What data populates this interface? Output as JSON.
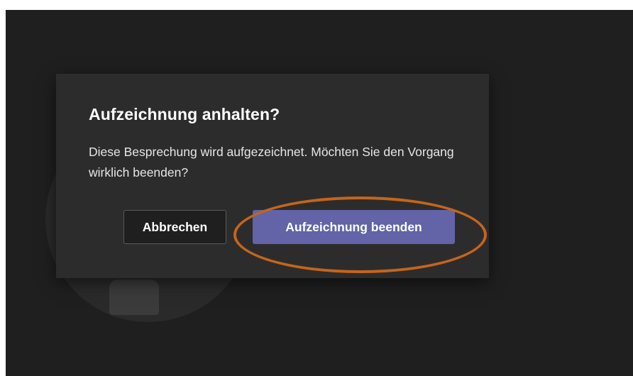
{
  "dialog": {
    "title": "Aufzeichnung anhalten?",
    "message": "Diese Besprechung wird aufgezeichnet. Möchten Sie den Vorgang wirklich beenden?",
    "cancel_label": "Abbrechen",
    "confirm_label": "Aufzeichnung beenden"
  },
  "colors": {
    "background": "#1f1f1f",
    "dialog_background": "#2d2c2c",
    "primary_button": "#6264a7",
    "highlight_annotation": "#c5651b"
  }
}
